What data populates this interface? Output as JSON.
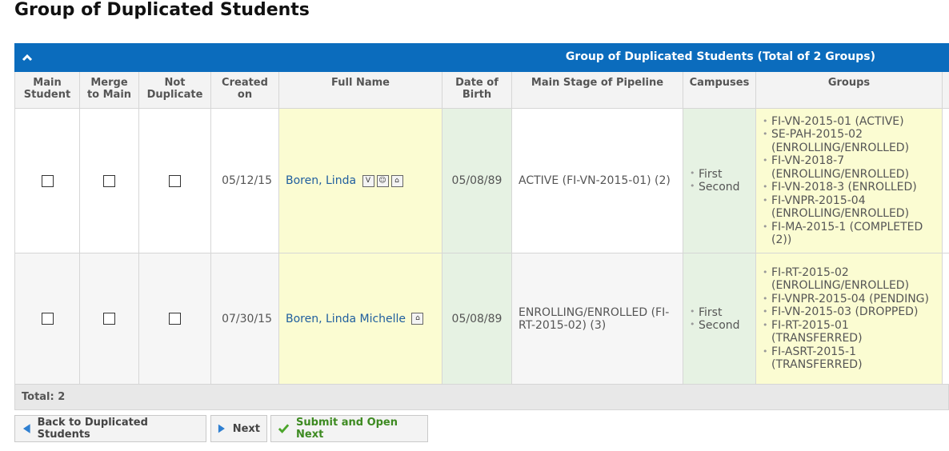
{
  "page": {
    "title": "Group of Duplicated Students"
  },
  "panel": {
    "title": "Group of Duplicated Students (Total of 2 Groups)",
    "columns": [
      "Main Student",
      "Merge to Main",
      "Not Duplicate",
      "Created on",
      "Full Name",
      "Date of Birth",
      "Main Stage of Pipeline",
      "Campuses",
      "Groups"
    ],
    "rows": [
      {
        "created_on": "05/12/15",
        "full_name": "Boren, Linda",
        "icons": [
          "v-badge-icon",
          "person-badge-icon",
          "home-badge-icon"
        ],
        "dob": "05/08/89",
        "stage": "ACTIVE (FI-VN-2015-01) (2)",
        "campuses": [
          "First",
          "Second"
        ],
        "groups": [
          "FI-VN-2015-01 (ACTIVE)",
          "SE-PAH-2015-02 (ENROLLING/ENROLLED)",
          "FI-VN-2018-7 (ENROLLING/ENROLLED)",
          "FI-VN-2018-3 (ENROLLED)",
          "FI-VNPR-2015-04 (ENROLLING/ENROLLED)",
          "FI-MA-2015-1 (COMPLETED (2))"
        ]
      },
      {
        "created_on": "07/30/15",
        "full_name": "Boren, Linda Michelle",
        "icons": [
          "home-badge-icon"
        ],
        "dob": "05/08/89",
        "stage": "ENROLLING/ENROLLED (FI-RT-2015-02) (3)",
        "campuses": [
          "First",
          "Second"
        ],
        "groups": [
          "FI-RT-2015-02 (ENROLLING/ENROLLED)",
          "FI-VNPR-2015-04 (PENDING)",
          "FI-VN-2015-03 (DROPPED)",
          "FI-RT-2015-01 (TRANSFERRED)",
          "FI-ASRT-2015-1 (TRANSFERRED)"
        ]
      }
    ],
    "total_label": "Total: 2"
  },
  "buttons": {
    "back": "Back to Duplicated Students",
    "next": "Next",
    "submit": "Submit and Open Next"
  },
  "colors": {
    "header_blue": "#0b6cbd",
    "name_bg": "#fbfcd2",
    "dob_bg": "#e6f2e3",
    "link": "#1f5e9e",
    "submit_green": "#3d8a21"
  }
}
